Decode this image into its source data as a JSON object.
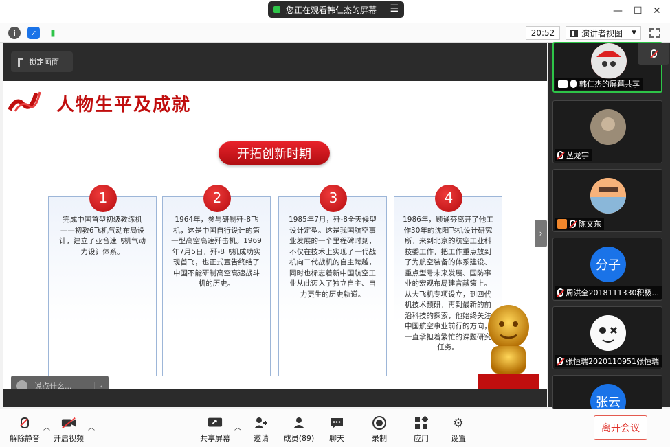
{
  "titlebar": {
    "share_status": "您正在观看韩仁杰的屏幕",
    "minimize": "—",
    "maximize": "☐",
    "close": "✕"
  },
  "toolbar": {
    "clock": "20:52",
    "view_mode": "演讲者视图"
  },
  "stage": {
    "lock_label": "锁定画面",
    "chat_placeholder": "说点什么...",
    "slide": {
      "title": "人物生平及成就",
      "period": "开拓创新时期",
      "cards": [
        {
          "num": "1",
          "text": "完成中国首型初级教练机——初教6飞机气动布局设计，建立了亚音速飞机气动力设计体系。"
        },
        {
          "num": "2",
          "text": "1964年，参与研制歼-8飞机，这是中国自行设计的第一型高空高速歼击机。1969年7月5日，歼-8飞机成功实现首飞，也正式宣告终结了中国不能研制高空高速战斗机的历史。"
        },
        {
          "num": "3",
          "text": "1985年7月，歼-8全天候型设计定型。这是我国航空事业发展的一个里程碑时刻，不仅在技术上实现了一代战机向二代战机的自主跨越，同时也标志着新中国航空工业从此迈入了独立自主、自力更生的历史轨道。"
        },
        {
          "num": "4",
          "text": "1986年，顾诵芬离开了他工作30年的沈阳飞机设计研究所，来到北京的航空工业科技委工作，把工作重点放到了为航空装备的体系建设、重点型号未来发展、国防事业的宏观布局建言献策上。从大飞机专项设立，到四代机技术预研，再到最新的前沿科技的探索，他始终关注中国航空事业前行的方向，一直承担着繁忙的课题研究任务。"
        }
      ]
    }
  },
  "participants": [
    {
      "name": "韩仁杰的屏幕共享",
      "avatar_text": "",
      "active": true
    },
    {
      "name": "丛龙宇",
      "avatar_text": ""
    },
    {
      "name": "陈文东",
      "avatar_text": ""
    },
    {
      "name": "周洪全2018111330积极...",
      "avatar_text": "分子",
      "avatar_color": "#1a73e8"
    },
    {
      "name": "张恒瑞2020110951张恒瑞",
      "avatar_text": ""
    },
    {
      "name": "",
      "avatar_text": "张云",
      "avatar_color": "#1a73e8"
    }
  ],
  "bottom": {
    "unmute": "解除静音",
    "start_video": "开启视频",
    "share_screen": "共享屏幕",
    "invite": "邀请",
    "members": "成员(89)",
    "chat": "聊天",
    "record": "录制",
    "apps": "应用",
    "settings": "设置",
    "leave": "离开会议"
  },
  "colors": {
    "accent_red": "#c00e0e",
    "active_green": "#2ec448",
    "leave_red": "#e0312a"
  }
}
